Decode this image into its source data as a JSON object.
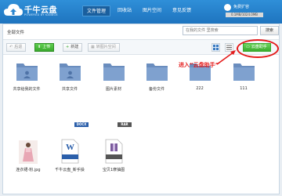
{
  "app": {
    "name": "千牛云盘",
    "subtitle": "POWERED BY KANBOX"
  },
  "nav": {
    "items": [
      "文件管理",
      "回收站",
      "图片空间",
      "意见反馈"
    ],
    "active": 0
  },
  "user": {
    "name": "免费扩容",
    "storage": "0.1MB/1024.0MB"
  },
  "breadcrumb": "全部文件",
  "search": {
    "placeholder": "在我的文件 里搜索",
    "button": "搜索"
  },
  "toolbar": {
    "back": "后退",
    "upload": "上传",
    "new": "新建",
    "move_to_image": "转图片空间",
    "cloud_helper": "云盘助手"
  },
  "annotation": "进入“云盘助手”",
  "files": [
    {
      "name": "共享给我的文件",
      "type": "folder-shared"
    },
    {
      "name": "共享文件",
      "type": "folder-shared"
    },
    {
      "name": "图片素材",
      "type": "folder"
    },
    {
      "name": "备份文件",
      "type": "folder"
    },
    {
      "name": "222",
      "type": "folder"
    },
    {
      "name": "111",
      "type": "folder"
    },
    {
      "name": "连衣裙-粉.jpg",
      "type": "image"
    },
    {
      "name": "千牛云盘_新手操",
      "type": "docx",
      "badge": "DOCX"
    },
    {
      "name": "宝贝1摩抽图",
      "type": "rar",
      "badge": "RAR"
    }
  ],
  "colors": {
    "header": "#2080c8",
    "accent": "#39a92d",
    "annotation": "#e41b1b",
    "folder": "#7f9fcb"
  }
}
